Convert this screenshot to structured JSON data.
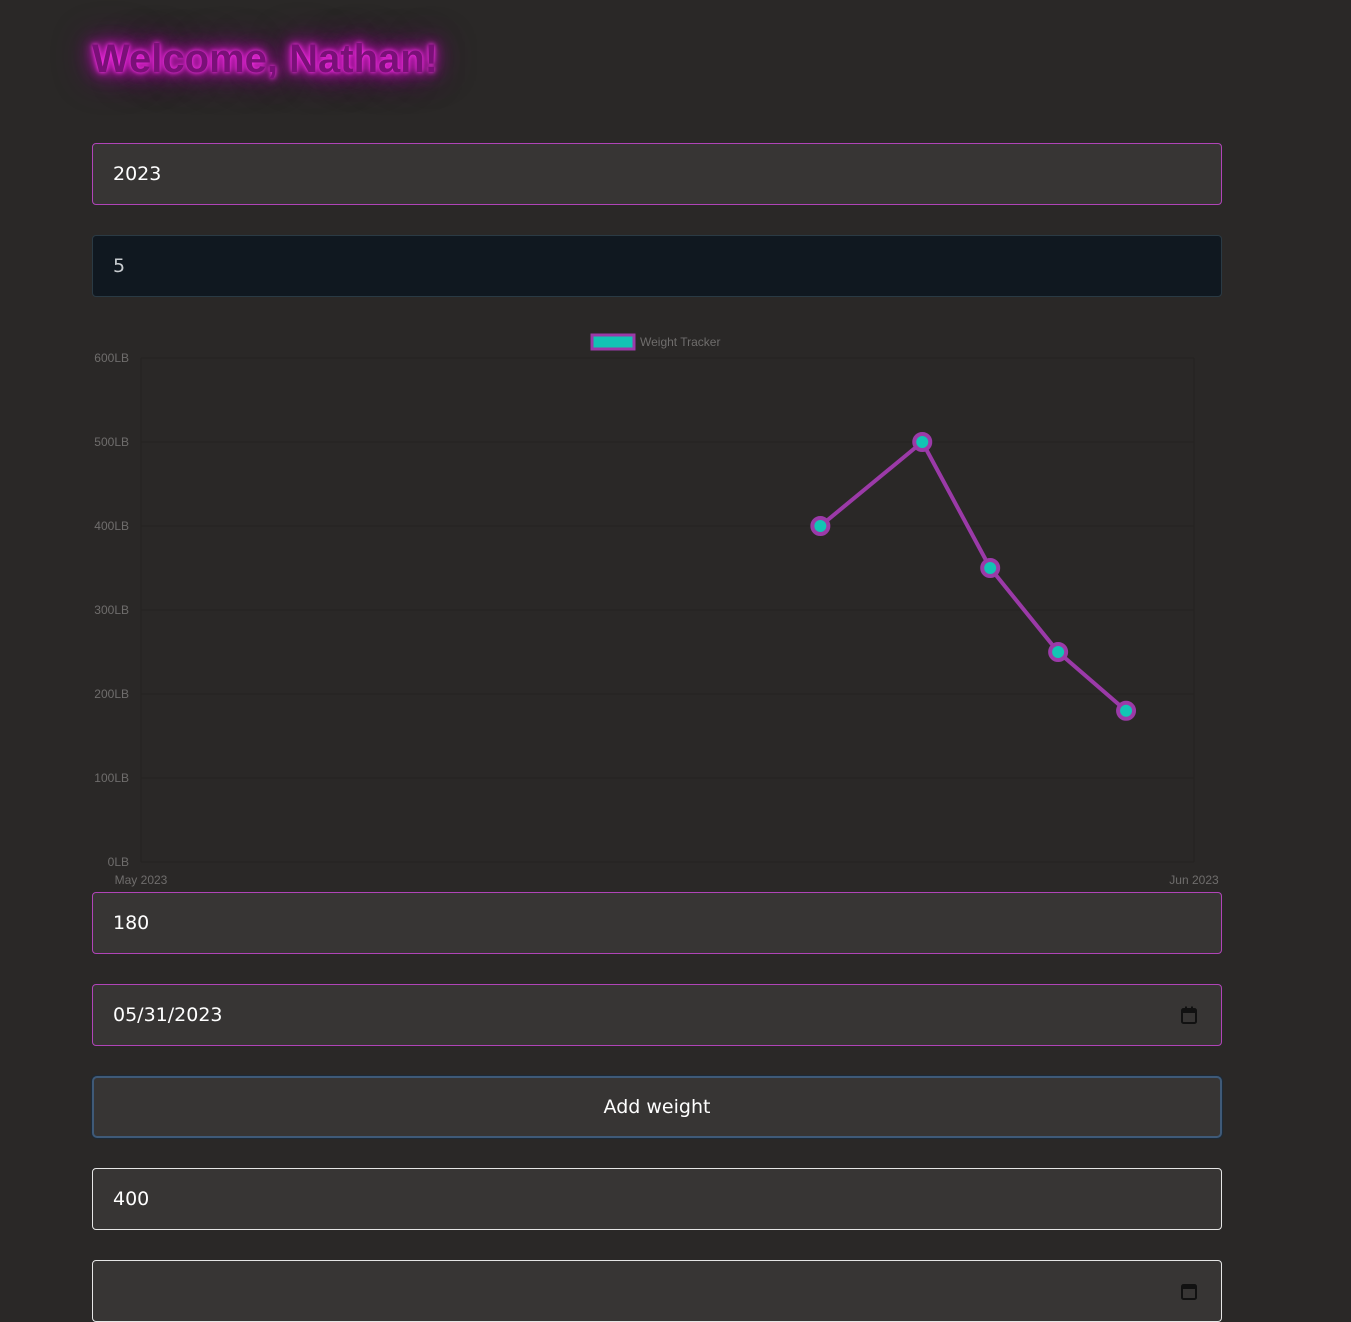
{
  "header": {
    "welcome_text": "Welcome, Nathan!"
  },
  "filters": {
    "year_value": "2023",
    "month_value": "5"
  },
  "chart_data": {
    "type": "line",
    "legend": [
      {
        "label": "Weight Tracker",
        "line_color": "#9b3aa8",
        "point_color": "#12c4b4"
      }
    ],
    "legend_position": "top",
    "x_ticks": [
      "May 2023",
      "Jun 2023"
    ],
    "xlim": [
      "2023-05-01",
      "2023-06-01"
    ],
    "y_ticks": [
      "0LB",
      "100LB",
      "200LB",
      "300LB",
      "400LB",
      "500LB",
      "600LB"
    ],
    "ylim": [
      0,
      600
    ],
    "grid": true,
    "series": [
      {
        "name": "Weight Tracker",
        "x": [
          "2023-05-21",
          "2023-05-24",
          "2023-05-26",
          "2023-05-28",
          "2023-05-30"
        ],
        "y": [
          400,
          500,
          350,
          250,
          180
        ]
      }
    ]
  },
  "form": {
    "weight_value": "180",
    "date_value": "05/31/2023",
    "add_button_label": "Add weight"
  },
  "entries": {
    "first_weight_value": "400",
    "second_value": ""
  },
  "colors": {
    "background": "#2a2827",
    "accent": "#b044b8",
    "line": "#9b3aa8",
    "point": "#12c4b4",
    "input_bg": "#373534",
    "dark_input_bg": "#101820"
  }
}
